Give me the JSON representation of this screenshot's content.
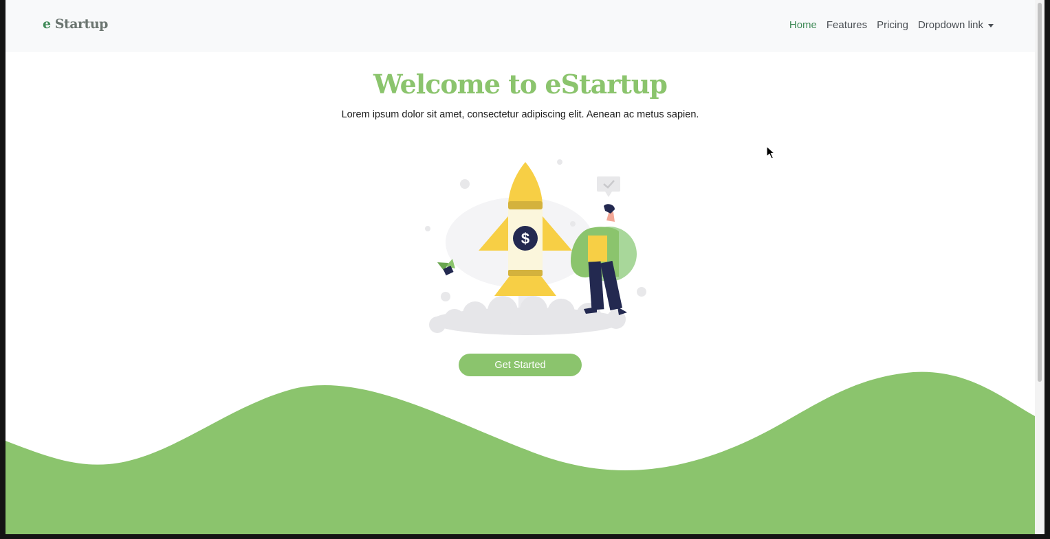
{
  "navbar": {
    "brand_prefix": "e",
    "brand_rest": "Startup",
    "items": [
      {
        "label": "Home"
      },
      {
        "label": "Features"
      },
      {
        "label": "Pricing"
      },
      {
        "label": "Dropdown link"
      }
    ]
  },
  "hero": {
    "title": "Welcome to eStartup",
    "subtitle": "Lorem ipsum dolor sit amet, consectetur adipiscing elit. Aenean ac metus sapien.",
    "cta_label": "Get Started",
    "illustration_icon": "rocket-launch-illustration",
    "currency_symbol": "$"
  },
  "colors": {
    "accent": "#8bc46d",
    "brand_green": "#3f8a57",
    "rocket_yellow": "#f7cf45",
    "navy": "#232950"
  }
}
